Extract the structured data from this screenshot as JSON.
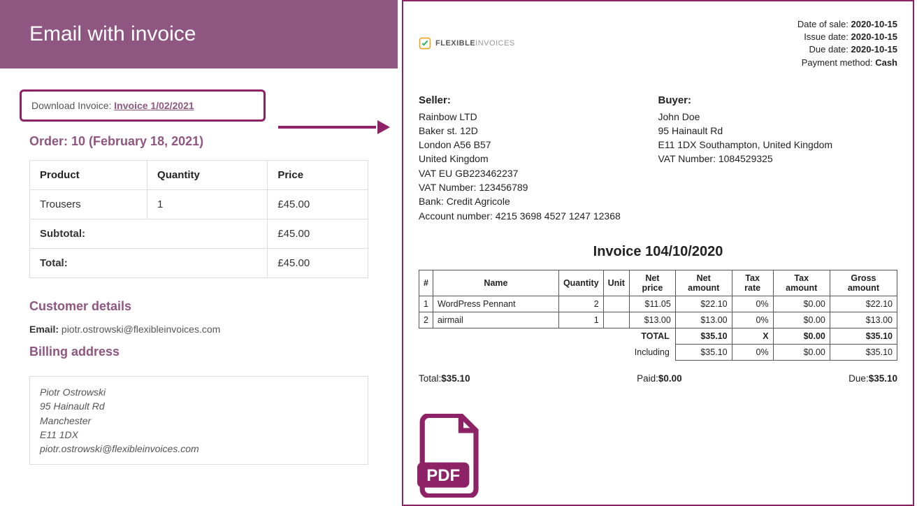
{
  "email": {
    "header_title": "Email with invoice",
    "download_prefix": "Download Invoice: ",
    "download_link_text": "Invoice 1/02/2021",
    "order_title": "Order: 10 (February 18, 2021)",
    "table": {
      "headers": {
        "product": "Product",
        "quantity": "Quantity",
        "price": "Price"
      },
      "row": {
        "product": "Trousers",
        "quantity": "1",
        "price": "£45.00"
      },
      "subtotal_label": "Subtotal:",
      "subtotal_value": "£45.00",
      "total_label": "Total:",
      "total_value": "£45.00"
    },
    "customer_heading": "Customer details",
    "email_label": "Email:",
    "email_value": "piotr.ostrowski@flexibleinvoices.com",
    "billing_heading": "Billing address",
    "billing": {
      "name": "Piotr Ostrowski",
      "street": "95 Hainault Rd",
      "city": "Manchester",
      "postcode": "E11 1DX",
      "email": "piotr.ostrowski@flexibleinvoices.com"
    }
  },
  "invoice": {
    "logo_text_a": "FLEXIBLE",
    "logo_text_b": "INVOICES",
    "meta": {
      "date_of_sale_label": "Date of sale:",
      "date_of_sale": "2020-10-15",
      "issue_date_label": "Issue date:",
      "issue_date": "2020-10-15",
      "due_date_label": "Due date:",
      "due_date": "2020-10-15",
      "payment_method_label": "Payment method:",
      "payment_method": "Cash"
    },
    "seller": {
      "heading": "Seller:",
      "name": "Rainbow LTD",
      "street": "Baker st. 12D",
      "city": "London A56 B57",
      "country": "United Kingdom",
      "vat_eu": "VAT EU GB223462237",
      "vat_number": "VAT Number: 123456789",
      "bank": "Bank: Credit Agricole",
      "account": "Account number: 4215 3698 4527 1247 12368"
    },
    "buyer": {
      "heading": "Buyer:",
      "name": "John Doe",
      "street": "95 Hainault Rd",
      "city": "E11 1DX Southampton, United Kingdom",
      "vat_number": "VAT Number: 1084529325"
    },
    "title": "Invoice 104/10/2020",
    "headers": {
      "num": "#",
      "name": "Name",
      "qty": "Quantity",
      "unit": "Unit",
      "net_price": "Net price",
      "net_amount": "Net amount",
      "tax_rate": "Tax rate",
      "tax_amount": "Tax amount",
      "gross": "Gross amount"
    },
    "items": [
      {
        "n": "1",
        "name": "WordPress Pennant",
        "qty": "2",
        "unit": "",
        "net_price": "$11.05",
        "net_amount": "$22.10",
        "tax_rate": "0%",
        "tax_amount": "$0.00",
        "gross": "$22.10"
      },
      {
        "n": "2",
        "name": "airmail",
        "qty": "1",
        "unit": "",
        "net_price": "$13.00",
        "net_amount": "$13.00",
        "tax_rate": "0%",
        "tax_amount": "$0.00",
        "gross": "$13.00"
      }
    ],
    "totals": {
      "total_label": "TOTAL",
      "total_net": "$35.10",
      "total_rate": "X",
      "total_tax": "$0.00",
      "total_gross": "$35.10",
      "including_label": "Including",
      "inc_net": "$35.10",
      "inc_rate": "0%",
      "inc_tax": "$0.00",
      "inc_gross": "$35.10"
    },
    "summary": {
      "total_label": "Total:",
      "total_value": "$35.10",
      "paid_label": "Paid:",
      "paid_value": "$0.00",
      "due_label": "Due:",
      "due_value": "$35.10"
    },
    "pdf_label": "PDF"
  }
}
